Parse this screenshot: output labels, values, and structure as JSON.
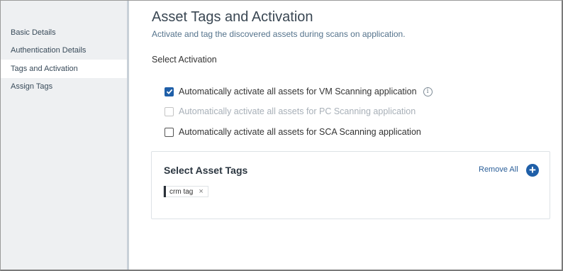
{
  "sidebar": {
    "items": [
      {
        "label": "Basic Details"
      },
      {
        "label": "Authentication Details"
      },
      {
        "label": "Tags and Activation"
      },
      {
        "label": "Assign Tags"
      }
    ]
  },
  "main": {
    "title": "Asset Tags and Activation",
    "subtitle": "Activate and tag the discovered assets during scans on application.",
    "activation_label": "Select Activation",
    "activations": [
      {
        "label": "Automatically activate all assets for VM Scanning application",
        "checked": true,
        "disabled": false
      },
      {
        "label": "Automatically activate all assets for PC Scanning application",
        "checked": false,
        "disabled": true
      },
      {
        "label": "Automatically activate all assets for SCA Scanning application",
        "checked": false,
        "disabled": false
      }
    ],
    "info_icon_glyph": "i",
    "asset_tags": {
      "title": "Select Asset Tags",
      "remove_all": "Remove All",
      "add_glyph": "+",
      "tags": [
        {
          "label": "crm tag",
          "close_glyph": "×"
        }
      ]
    }
  },
  "colors": {
    "accent": "#1f5fa8",
    "sidebar_bg": "#eef0f2",
    "link": "#2a5e98"
  }
}
